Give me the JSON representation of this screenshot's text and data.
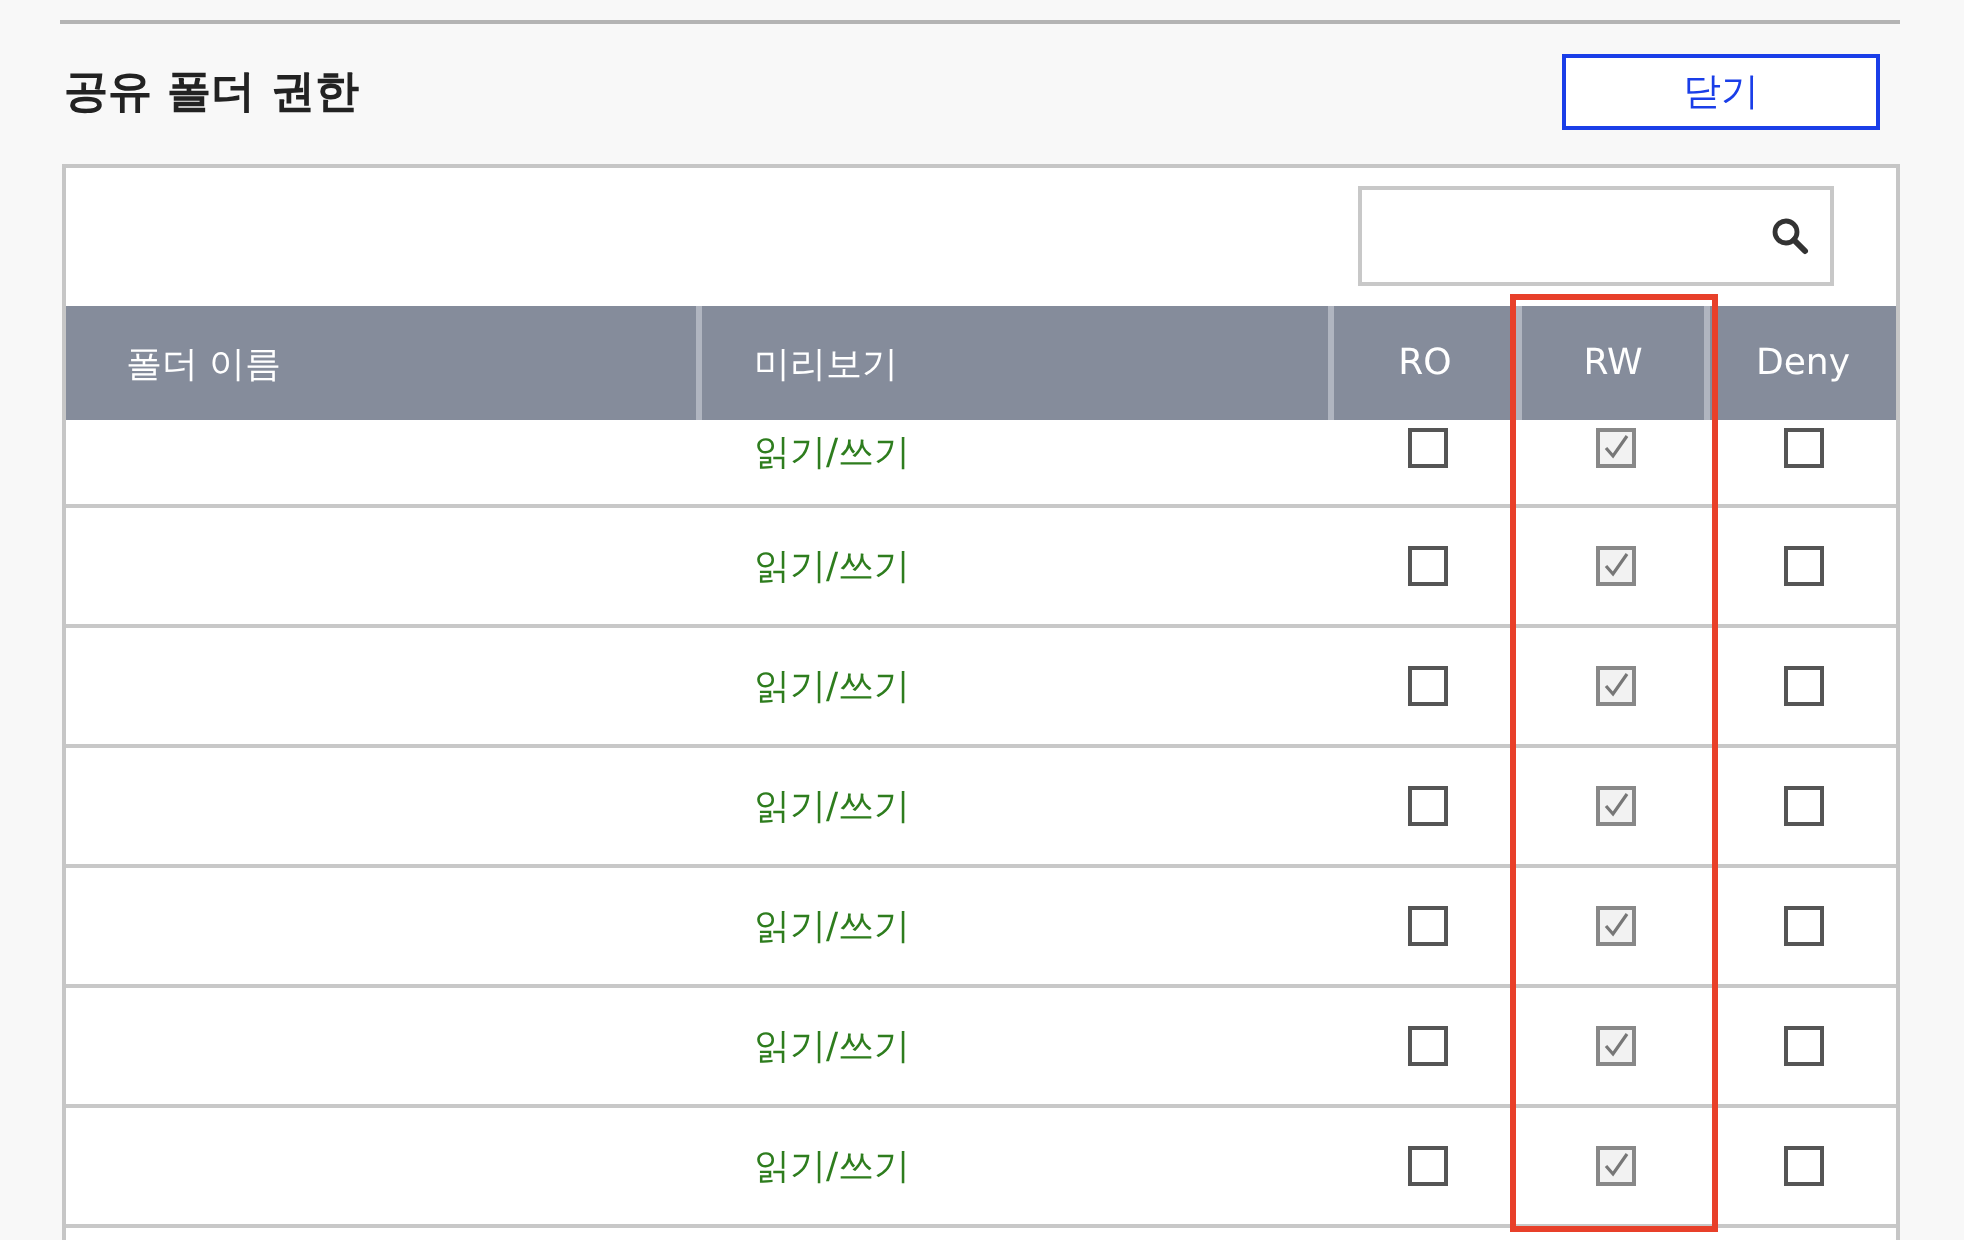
{
  "title": "공유 폴더 권한",
  "close_button": "닫기",
  "table": {
    "columns": [
      {
        "label": "폴더 이름",
        "highlighted": false
      },
      {
        "label": "미리보기",
        "highlighted": false
      },
      {
        "label": "RO",
        "highlighted": false
      },
      {
        "label": "RW",
        "highlighted": true
      },
      {
        "label": "Deny",
        "highlighted": false
      }
    ],
    "rows": [
      {
        "preview": "읽기/쓰기",
        "ro": false,
        "rw": true,
        "deny": false
      },
      {
        "preview": "읽기/쓰기",
        "ro": false,
        "rw": true,
        "deny": false
      },
      {
        "preview": "읽기/쓰기",
        "ro": false,
        "rw": true,
        "deny": false
      },
      {
        "preview": "읽기/쓰기",
        "ro": false,
        "rw": true,
        "deny": false
      },
      {
        "preview": "읽기/쓰기",
        "ro": false,
        "rw": true,
        "deny": false
      },
      {
        "preview": "읽기/쓰기",
        "ro": false,
        "rw": true,
        "deny": false
      },
      {
        "preview": "읽기/쓰기",
        "ro": false,
        "rw": true,
        "deny": false
      }
    ]
  }
}
